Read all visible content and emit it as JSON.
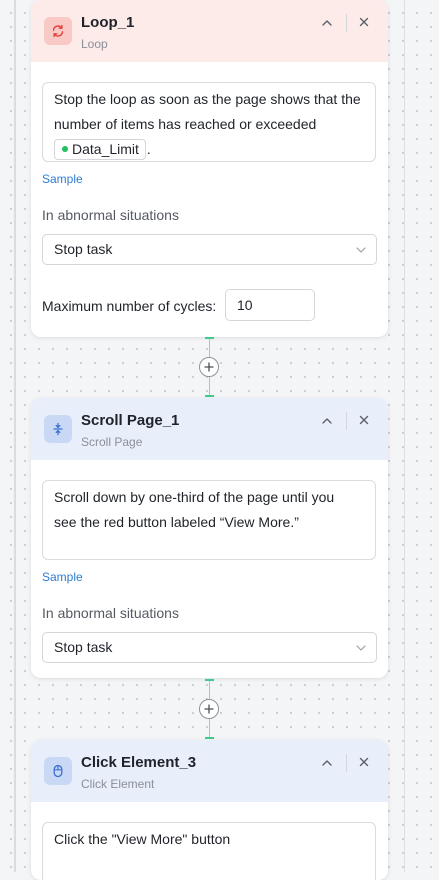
{
  "steps": [
    {
      "title": "Loop_1",
      "subtitle": "Loop",
      "icon": "loop-icon",
      "header_color": "#fdebea",
      "prompt_lines": [
        "Stop the loop as soon as the page shows that the",
        "number of items has reached or exceeded"
      ],
      "variable_chip": "Data_Limit",
      "prompt_suffix": ".",
      "sample_label": "Sample",
      "abnormal_label": "In abnormal situations",
      "abnormal_value": "Stop task",
      "max_cycles_label": "Maximum number of cycles:",
      "max_cycles_value": "10"
    },
    {
      "title": "Scroll Page_1",
      "subtitle": "Scroll Page",
      "icon": "scroll-page-icon",
      "header_color": "#e8effb",
      "prompt_lines": [
        "Scroll down by one-third of the page until you",
        "see the red button labeled “View More.”"
      ],
      "sample_label": "Sample",
      "abnormal_label": "In abnormal situations",
      "abnormal_value": "Stop task"
    },
    {
      "title": "Click Element_3",
      "subtitle": "Click Element",
      "icon": "mouse-click-icon",
      "header_color": "#e8effb",
      "prompt_lines": [
        "Click the \"View More\" button"
      ]
    }
  ],
  "colors": {
    "accent_link": "#2d7dd2",
    "connector_green": "#3ecb8f",
    "chip_dot": "#20c15d"
  }
}
